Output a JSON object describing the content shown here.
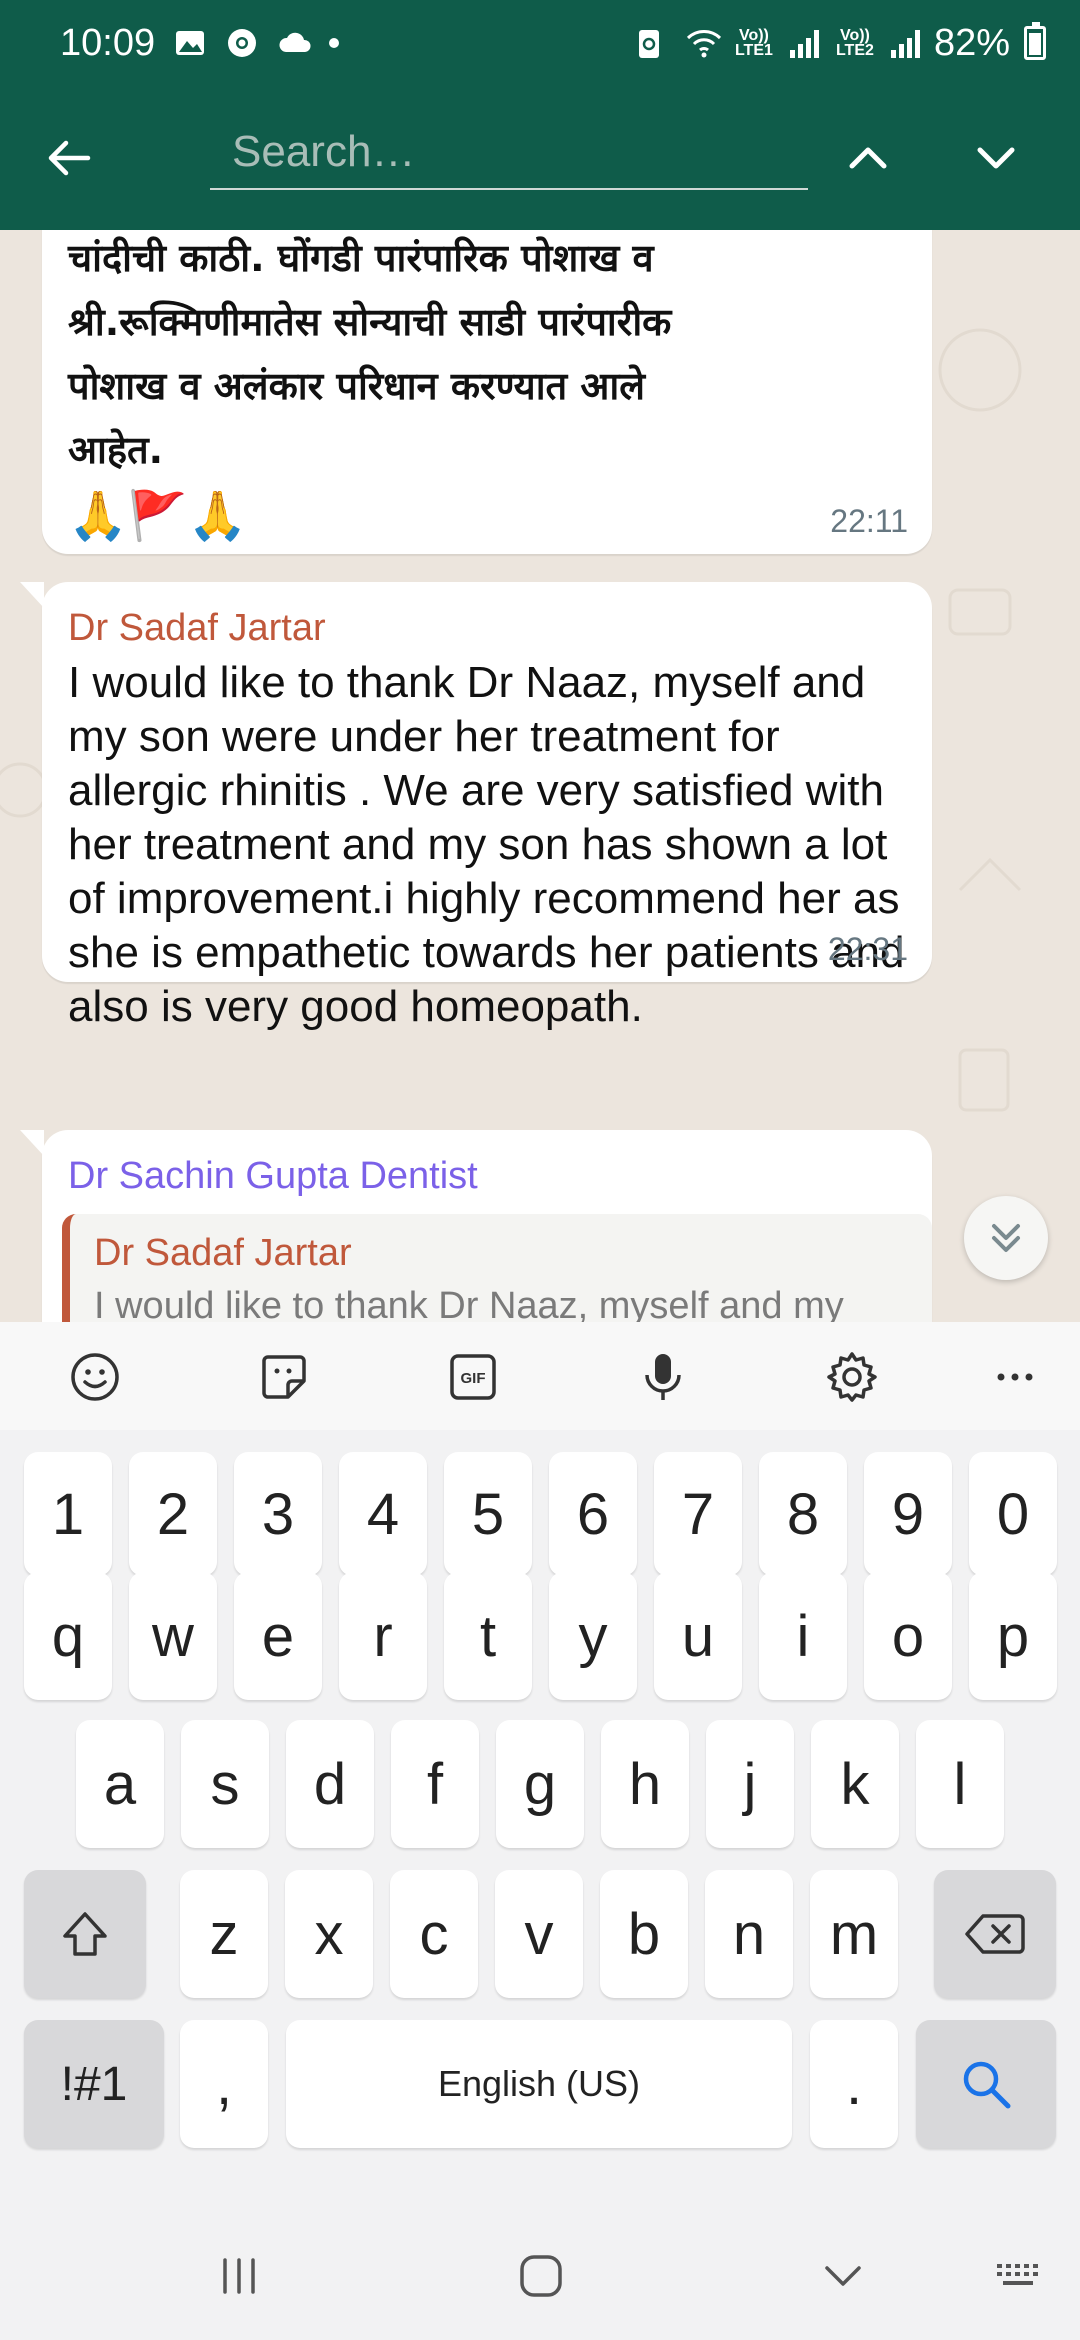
{
  "status_bar": {
    "time": "10:09",
    "lte1": "Vo)) LTE1",
    "lte2": "Vo)) LTE2",
    "battery": "82%"
  },
  "search": {
    "placeholder": "Search…",
    "value": ""
  },
  "messages": [
    {
      "text_lines": [
        "चांदीची काठी. घोंगडी पारंपारिक पोशाख व",
        "श्री.रूक्मिणीमातेस सोन्याची साडी पारंपारीक",
        "पोशाख व अलंकार परिधान करण्यात आले",
        "आहेत."
      ],
      "emojis": "🙏🚩🙏",
      "time": "22:11"
    },
    {
      "sender": "Dr Sadaf Jartar",
      "sender_color": "#c0583b",
      "text": "I would like to thank Dr Naaz, myself and my son were under her treatment for allergic rhinitis . We  are very satisfied with  her treatment and my son has shown a lot of improvement.i highly recommend her as she is empathetic towards her patients and also is very good homeopath.",
      "time": "22:31"
    },
    {
      "sender": "Dr Sachin Gupta Dentist",
      "sender_color": "#7b61e8",
      "quote": {
        "sender": "Dr Sadaf Jartar",
        "text": "I would like to thank Dr Naaz, myself and my"
      }
    }
  ],
  "keyboard": {
    "toolbar": [
      "emoji-icon",
      "sticker-icon",
      "gif-icon",
      "microphone-icon",
      "settings-icon",
      "more-icon"
    ],
    "gif_label": "GIF",
    "more_label": "...",
    "row_numbers": [
      "1",
      "2",
      "3",
      "4",
      "5",
      "6",
      "7",
      "8",
      "9",
      "0"
    ],
    "row1": [
      "q",
      "w",
      "e",
      "r",
      "t",
      "y",
      "u",
      "i",
      "o",
      "p"
    ],
    "row2": [
      "a",
      "s",
      "d",
      "f",
      "g",
      "h",
      "j",
      "k",
      "l"
    ],
    "row3": [
      "z",
      "x",
      "c",
      "v",
      "b",
      "n",
      "m"
    ],
    "symbols_label": "!#1",
    "comma_label": ",",
    "space_label": "English (US)",
    "period_label": "."
  },
  "colors": {
    "header": "#0f5c4a",
    "accent_search": "#1a73e8"
  }
}
